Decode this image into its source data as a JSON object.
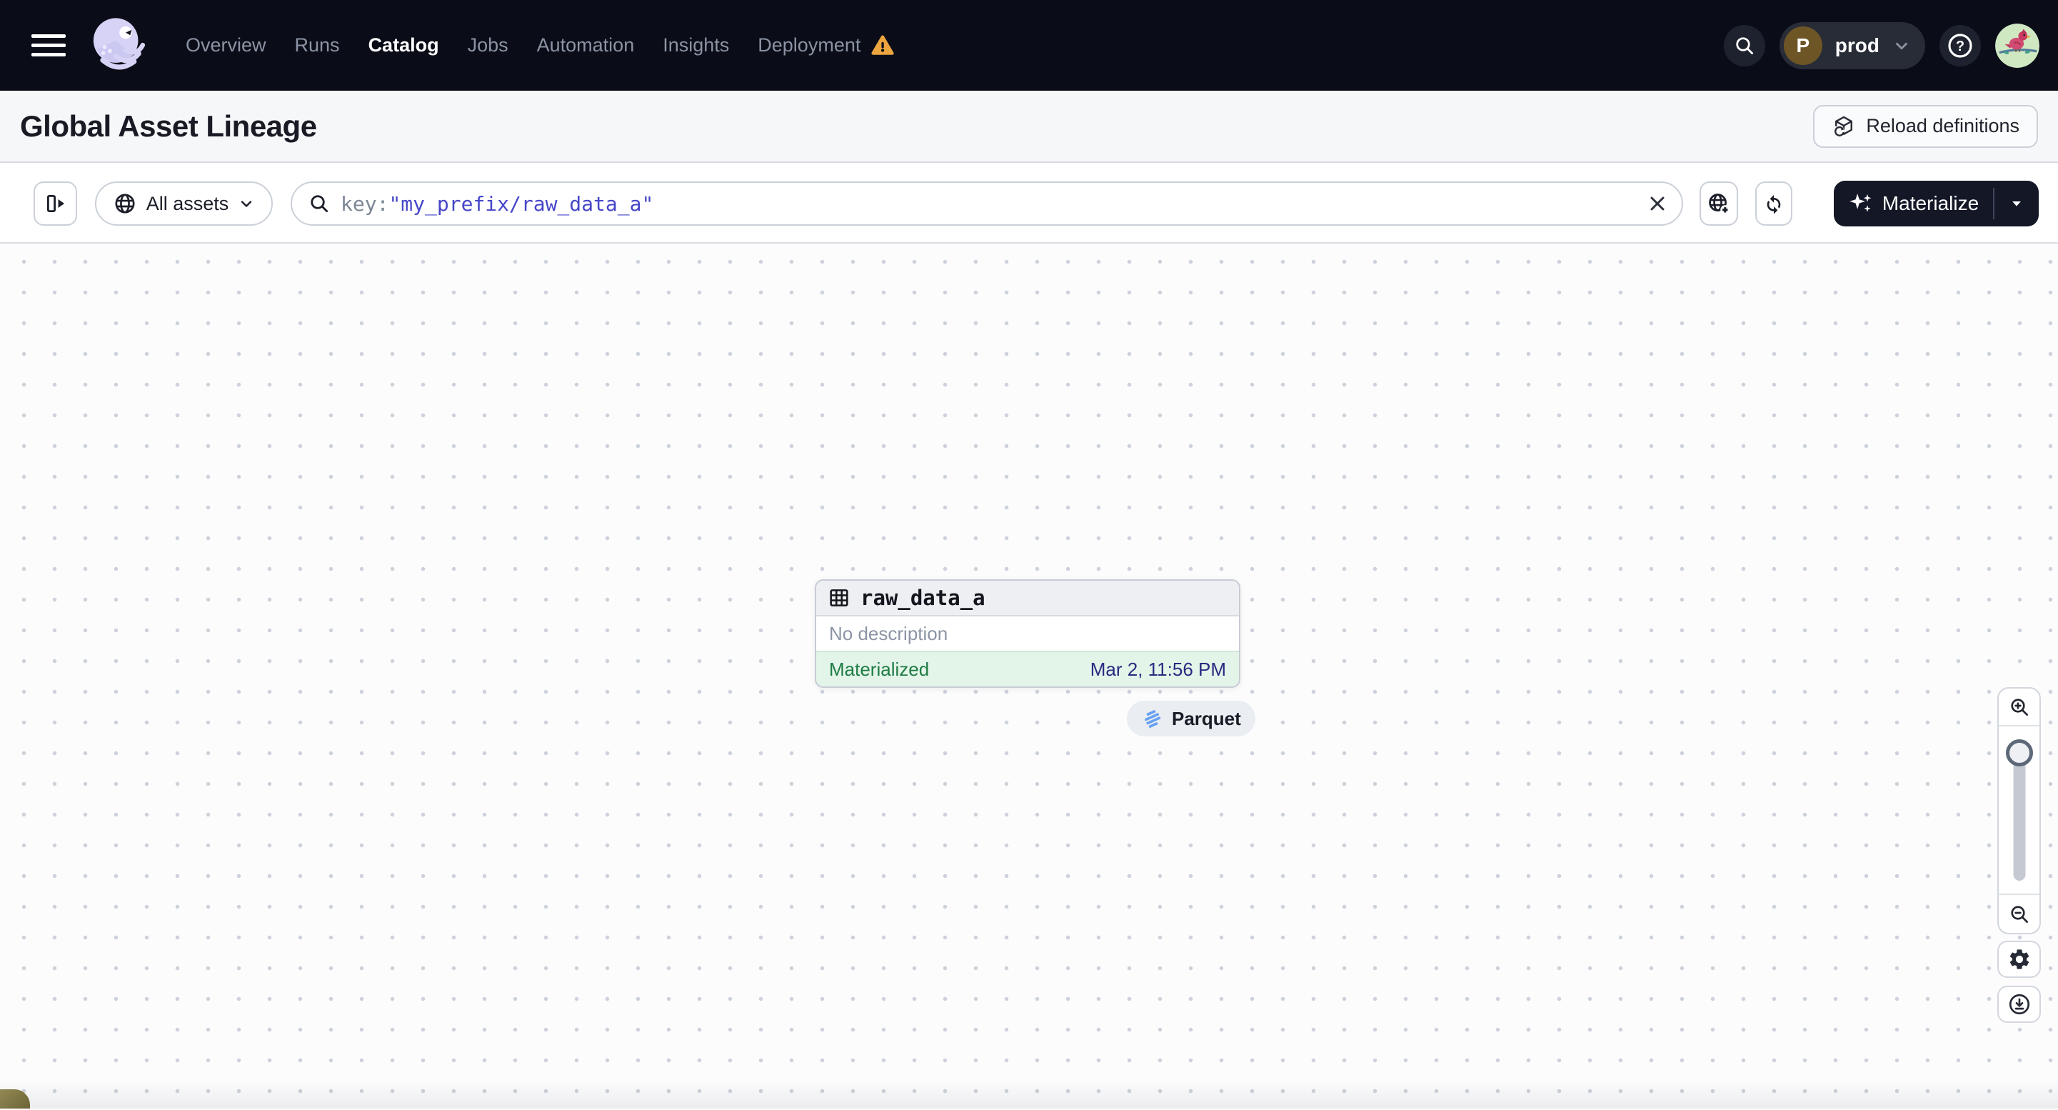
{
  "nav": {
    "items": [
      "Overview",
      "Runs",
      "Catalog",
      "Jobs",
      "Automation",
      "Insights",
      "Deployment"
    ],
    "active_item": "Catalog",
    "deployment_switcher": {
      "initial": "P",
      "name": "prod"
    }
  },
  "header": {
    "title": "Global Asset Lineage",
    "reload_button_label": "Reload definitions"
  },
  "toolbar": {
    "scope_dropdown_label": "All assets",
    "search": {
      "prefix": "key:",
      "value": "\"my_prefix/raw_data_a\""
    },
    "materialize_button_label": "Materialize"
  },
  "graph": {
    "asset_node": {
      "name": "raw_data_a",
      "description": "No description",
      "status": "Materialized",
      "materialized_at": "Mar 2, 11:56 PM",
      "compute_kind_tag": "Parquet"
    }
  },
  "icons": {
    "logo": "dagster-octopus",
    "nav_search": "magnifier",
    "help": "question-circle",
    "deployment_warning": "warning-triangle",
    "reload": "cube-reload",
    "panel_toggle": "expand-panel",
    "scope": "globe",
    "open_in_new": "globe-plus",
    "refresh": "sync-arrows",
    "materialize": "sparkles",
    "asset_type": "table-grid",
    "tag": "parquet-logo",
    "zoom_in": "magnifier-plus",
    "zoom_out": "magnifier-minus",
    "settings": "gear",
    "export": "download-circle"
  },
  "colors": {
    "nav_bg": "#0a0d17",
    "nav_inactive": "#8b93a4",
    "warning": "#eda53f",
    "accent_link": "#4646c8",
    "materialized_bg": "#e3f4e9",
    "materialized_text": "#1e7c44",
    "timestamp_text": "#2b2a80",
    "dark_button": "#131726",
    "parquet_blue": "#66a0f4"
  }
}
